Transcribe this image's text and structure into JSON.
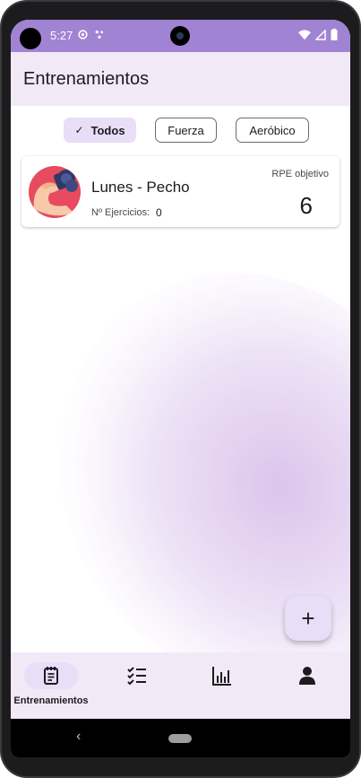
{
  "status_bar": {
    "time": "5:27",
    "left_icons": [
      "gear-icon",
      "notification-dots-icon"
    ],
    "right_icons": [
      "wifi-icon",
      "signal-icon",
      "battery-icon"
    ]
  },
  "app_bar": {
    "title": "Entrenamientos"
  },
  "filters": {
    "selected": "Todos",
    "chips": [
      {
        "label": "Todos",
        "selected": true
      },
      {
        "label": "Fuerza",
        "selected": false
      },
      {
        "label": "Aeróbico",
        "selected": false
      }
    ]
  },
  "workouts": [
    {
      "title": "Lunes - Pecho",
      "exercises_label": "Nº Ejercicios:",
      "exercises_count": "0",
      "rpe_label": "RPE objetivo",
      "rpe_value": "6",
      "image": "flexed-arm-dumbbell-icon"
    }
  ],
  "fab": {
    "label": "+",
    "icon": "add-icon"
  },
  "bottom_nav": {
    "active": "Entrenamientos",
    "items": [
      {
        "label": "Entrenamientos",
        "icon": "workout-notebook-icon",
        "active": true
      },
      {
        "label": "",
        "icon": "checklist-icon",
        "active": false
      },
      {
        "label": "",
        "icon": "bar-chart-icon",
        "active": false
      },
      {
        "label": "",
        "icon": "person-icon",
        "active": false
      }
    ]
  },
  "colors": {
    "status_bar": "#a183d3",
    "app_bar": "#f2e9f7",
    "chip_selected": "#e8def8",
    "avatar": "#e84a5f",
    "system_nav": "#000000"
  }
}
